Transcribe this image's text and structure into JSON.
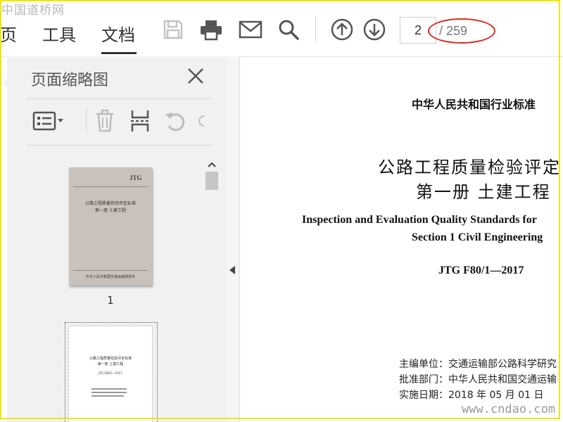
{
  "watermark_top": "中国道桥网",
  "watermark_bottom": "www.cndao.com",
  "toolbar": {
    "nav_partial": "页",
    "nav_tools": "工具",
    "nav_document": "文档",
    "icons": [
      "save-icon",
      "print-icon",
      "email-icon",
      "search-icon",
      "page-up-icon",
      "page-down-icon"
    ],
    "current_page": "2",
    "total_pages": "/ 259"
  },
  "side_panel": {
    "title": "页面缩略图",
    "tools": [
      "thumbnail-options-icon",
      "delete-icon",
      "extract-icon",
      "rotate-ccw-icon",
      "rotate-cw-icon"
    ],
    "thumbnails": [
      {
        "label": "1",
        "brand": "JTG",
        "title1": "公路工程质量检验评定标准",
        "title2": "第一册  土建工程",
        "publisher": "中华人民共和国交通运输部发布"
      },
      {
        "label": "",
        "title1": "公路工程质量检验评定标准",
        "title2": "第一册  土建工程",
        "code": "JTG F80/1—2017"
      }
    ]
  },
  "document": {
    "header": "中华人民共和国行业标准",
    "title_cn": "公路工程质量检验评定",
    "subtitle_cn": "第一册    土建工程",
    "title_en": "Inspection and Evaluation Quality Standards for",
    "subtitle_en": "Section 1    Civil Engineering",
    "code": "JTG  F80/1—2017",
    "info": [
      "主编单位：交通运输部公路科学研究",
      "批准部门：中华人民共和国交通运输",
      "实施日期：2018 年 05 月 01 日"
    ]
  },
  "colors": {
    "frame": "#f2e600",
    "annotation": "#d8281d",
    "cover": "#c9c2bc"
  }
}
